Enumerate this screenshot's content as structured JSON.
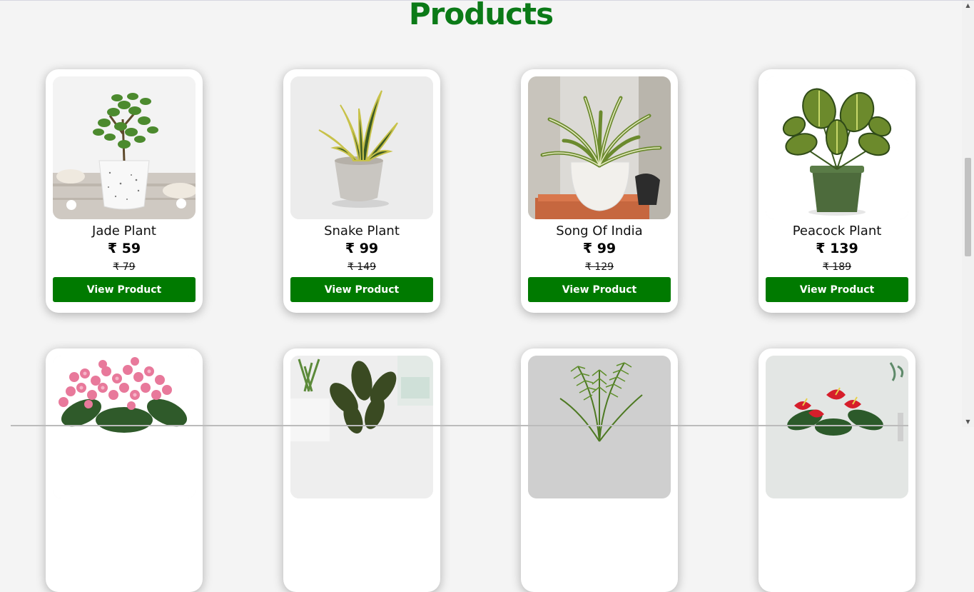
{
  "page": {
    "title": "Products"
  },
  "colors": {
    "brand_green": "#0b7a17",
    "button_green": "#007a00"
  },
  "button_label": "View Product",
  "currency_symbol": "₹",
  "products": [
    {
      "name": "Jade Plant",
      "price": "₹ 59",
      "old_price": "₹ 79",
      "image": "jade-plant-image"
    },
    {
      "name": "Snake Plant",
      "price": "₹ 99",
      "old_price": "₹ 149",
      "image": "snake-plant-image"
    },
    {
      "name": "Song Of India",
      "price": "₹ 99",
      "old_price": "₹ 129",
      "image": "song-of-india-image"
    },
    {
      "name": "Peacock Plant",
      "price": "₹ 139",
      "old_price": "₹ 189",
      "image": "peacock-plant-image"
    },
    {
      "image": "kalanchoe-image"
    },
    {
      "image": "rubber-plant-image"
    },
    {
      "image": "areca-palm-image"
    },
    {
      "image": "anthurium-image"
    }
  ]
}
